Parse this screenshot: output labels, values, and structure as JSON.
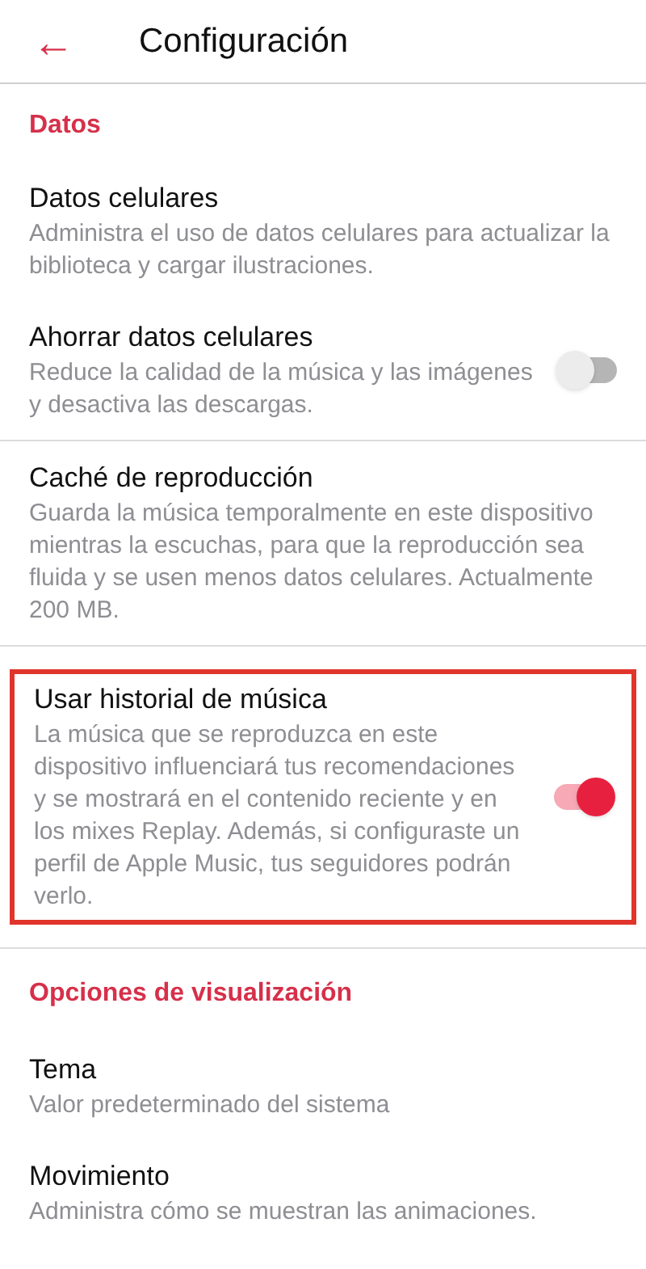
{
  "header": {
    "back_icon": "←",
    "title": "Configuración"
  },
  "sections": [
    {
      "title": "Datos",
      "items": [
        {
          "kind": "plain",
          "title": "Datos celulares",
          "description": "Administra el uso de datos celulares para actualizar la biblioteca y cargar ilustraciones.",
          "divider": false,
          "highlighted": false
        },
        {
          "kind": "toggle",
          "title": "Ahorrar datos celulares",
          "description": "Reduce la calidad de la música y las imágenes y desactiva las descargas.",
          "on": false,
          "divider": true,
          "highlighted": false
        },
        {
          "kind": "plain",
          "title": "Caché de reproducción",
          "description": "Guarda la música temporalmente en este dispositivo mientras la escuchas, para que la reproducción sea fluida y se usen menos datos celulares. Actualmente 200 MB.",
          "divider": true,
          "highlighted": false
        },
        {
          "kind": "toggle",
          "title": "Usar historial de música",
          "description": "La música que se reproduzca en este dispositivo influenciará tus recomendaciones y se mostrará en el contenido reciente y en los mixes Replay. Además, si configuraste un perfil de Apple Music, tus seguidores podrán verlo.",
          "on": true,
          "divider": true,
          "highlighted": true
        }
      ]
    },
    {
      "title": "Opciones de visualización",
      "items": [
        {
          "kind": "plain",
          "title": "Tema",
          "description": "Valor predeterminado del sistema",
          "divider": false,
          "highlighted": false
        },
        {
          "kind": "plain",
          "title": "Movimiento",
          "description": "Administra cómo se muestran las animaciones.",
          "divider": false,
          "highlighted": false
        }
      ]
    }
  ]
}
